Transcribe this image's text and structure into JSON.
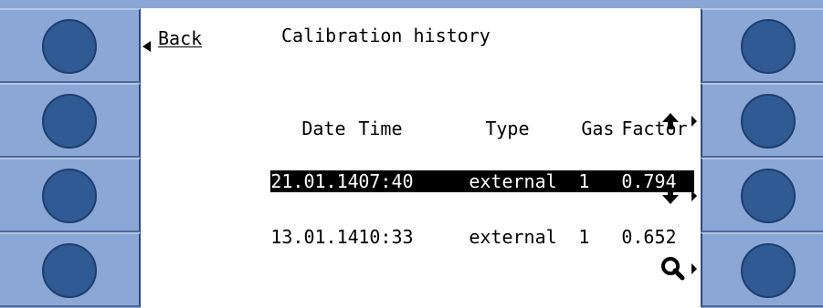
{
  "header": {
    "back_label_first": "B",
    "back_label_rest": "ack",
    "title": "Calibration history"
  },
  "table": {
    "columns": [
      "Date",
      "Time",
      "Type",
      "Gas",
      "Factor"
    ],
    "rows": [
      {
        "date": "21.01.14",
        "time": "07:40",
        "type": "external",
        "gas": "1",
        "factor": "0.794",
        "selected": true
      },
      {
        "date": "13.01.14",
        "time": "10:33",
        "type": "external",
        "gas": "1",
        "factor": "0.652",
        "selected": false
      }
    ]
  },
  "nav": {
    "up_icon": "arrow-up-icon",
    "down_icon": "arrow-down-icon",
    "search_icon": "magnifier-icon"
  },
  "colors": {
    "bezel": "#8aa6d4",
    "knob": "#2f5a94",
    "screen": "#ffffff",
    "selection": "#000000"
  }
}
